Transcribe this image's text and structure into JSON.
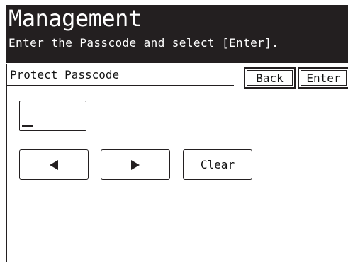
{
  "header": {
    "title": "Management",
    "subtitle": "Enter the Passcode and select [Enter]."
  },
  "form": {
    "label": "Protect Passcode",
    "passcode_value": ""
  },
  "buttons": {
    "back": "Back",
    "enter": "Enter",
    "clear": "Clear"
  },
  "icons": {
    "left": "arrow-left-triangle-icon",
    "right": "arrow-right-triangle-icon"
  },
  "colors": {
    "header_bg": "#231f20",
    "header_text": "#ffffff",
    "line": "#231f20"
  }
}
